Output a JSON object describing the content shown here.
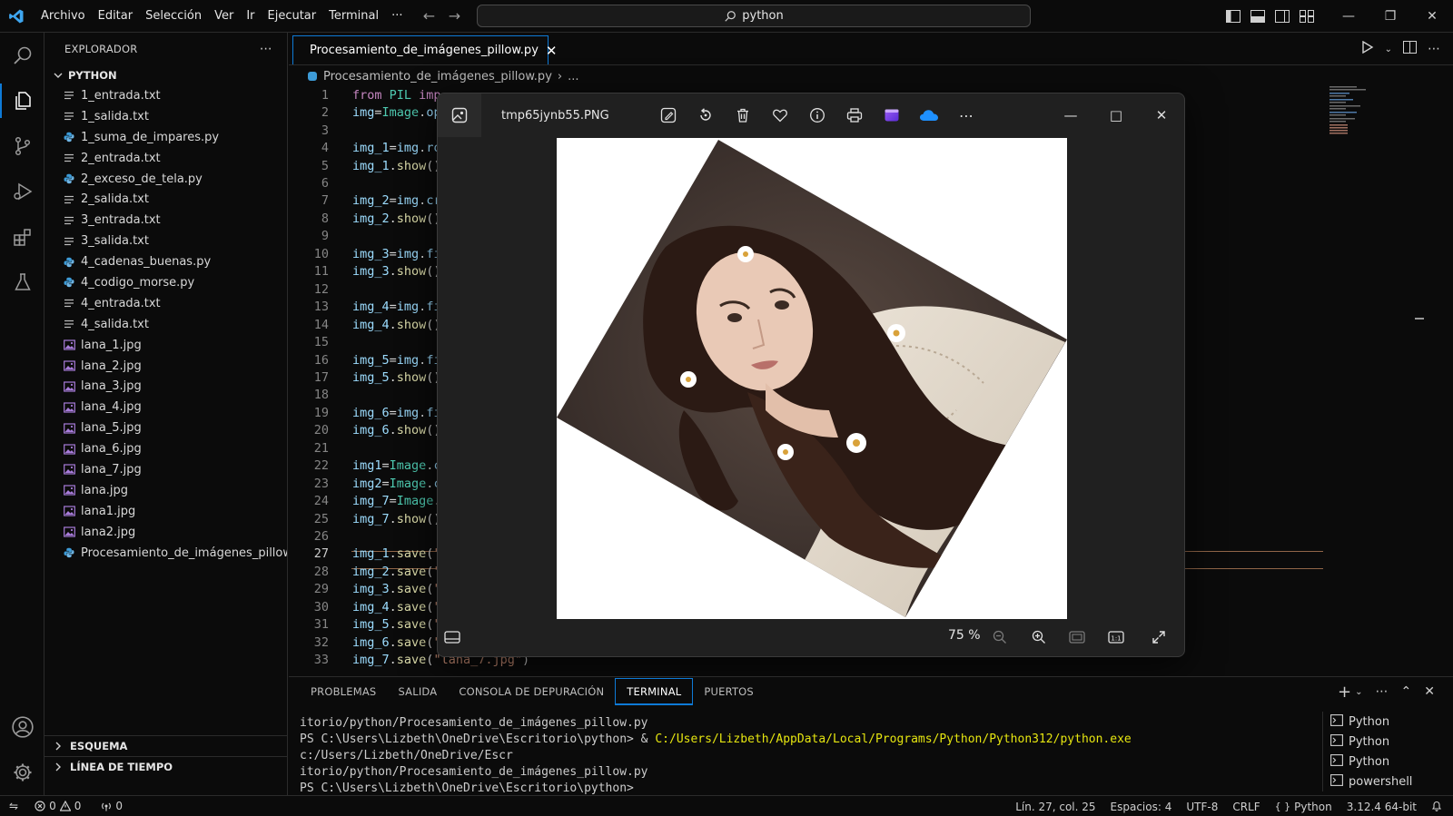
{
  "titlebar": {
    "menu": [
      "Archivo",
      "Editar",
      "Selección",
      "Ver",
      "Ir",
      "Ejecutar",
      "Terminal",
      "···"
    ],
    "search_text": "python"
  },
  "sidebar": {
    "title": "EXPLORADOR",
    "folder": "PYTHON",
    "files": [
      {
        "name": "1_entrada.txt",
        "type": "txt"
      },
      {
        "name": "1_salida.txt",
        "type": "txt"
      },
      {
        "name": "1_suma_de_impares.py",
        "type": "py"
      },
      {
        "name": "2_entrada.txt",
        "type": "txt"
      },
      {
        "name": "2_exceso_de_tela.py",
        "type": "py"
      },
      {
        "name": "2_salida.txt",
        "type": "txt"
      },
      {
        "name": "3_entrada.txt",
        "type": "txt"
      },
      {
        "name": "3_salida.txt",
        "type": "txt"
      },
      {
        "name": "4_cadenas_buenas.py",
        "type": "py"
      },
      {
        "name": "4_codigo_morse.py",
        "type": "py"
      },
      {
        "name": "4_entrada.txt",
        "type": "txt"
      },
      {
        "name": "4_salida.txt",
        "type": "txt"
      },
      {
        "name": "lana_1.jpg",
        "type": "img"
      },
      {
        "name": "lana_2.jpg",
        "type": "img"
      },
      {
        "name": "lana_3.jpg",
        "type": "img"
      },
      {
        "name": "lana_4.jpg",
        "type": "img"
      },
      {
        "name": "lana_5.jpg",
        "type": "img"
      },
      {
        "name": "lana_6.jpg",
        "type": "img"
      },
      {
        "name": "lana_7.jpg",
        "type": "img"
      },
      {
        "name": "lana.jpg",
        "type": "img"
      },
      {
        "name": "lana1.jpg",
        "type": "img"
      },
      {
        "name": "lana2.jpg",
        "type": "img"
      },
      {
        "name": "Procesamiento_de_imágenes_pillow....",
        "type": "py"
      }
    ],
    "outline": "ESQUEMA",
    "timeline": "LÍNEA DE TIEMPO"
  },
  "editor": {
    "tab_label": "Procesamiento_de_imágenes_pillow.py",
    "breadcrumb_file": "Procesamiento_de_imágenes_pillow.py",
    "breadcrumb_more": "...",
    "current_line": 27
  },
  "code_lines": [
    {
      "n": "1",
      "parts": [
        [
          "kw",
          "from "
        ],
        [
          "cls",
          "PIL "
        ],
        [
          "kw",
          "imp"
        ]
      ]
    },
    {
      "n": "2",
      "parts": [
        [
          "var",
          "img"
        ],
        [
          "op",
          "="
        ],
        [
          "cls",
          "Image"
        ],
        [
          "op",
          "."
        ],
        [
          "var",
          "op"
        ]
      ]
    },
    {
      "n": "3",
      "parts": []
    },
    {
      "n": "4",
      "parts": [
        [
          "var",
          "img_1"
        ],
        [
          "op",
          "="
        ],
        [
          "var",
          "img"
        ],
        [
          "op",
          "."
        ],
        [
          "var",
          "ro"
        ]
      ]
    },
    {
      "n": "5",
      "parts": [
        [
          "var",
          "img_1"
        ],
        [
          "op",
          "."
        ],
        [
          "fn",
          "show"
        ],
        [
          "op",
          "()"
        ]
      ]
    },
    {
      "n": "6",
      "parts": []
    },
    {
      "n": "7",
      "parts": [
        [
          "var",
          "img_2"
        ],
        [
          "op",
          "="
        ],
        [
          "var",
          "img"
        ],
        [
          "op",
          "."
        ],
        [
          "var",
          "cr"
        ]
      ]
    },
    {
      "n": "8",
      "parts": [
        [
          "var",
          "img_2"
        ],
        [
          "op",
          "."
        ],
        [
          "fn",
          "show"
        ],
        [
          "op",
          "()"
        ]
      ]
    },
    {
      "n": "9",
      "parts": []
    },
    {
      "n": "10",
      "parts": [
        [
          "var",
          "img_3"
        ],
        [
          "op",
          "="
        ],
        [
          "var",
          "img"
        ],
        [
          "op",
          "."
        ],
        [
          "var",
          "fi"
        ]
      ]
    },
    {
      "n": "11",
      "parts": [
        [
          "var",
          "img_3"
        ],
        [
          "op",
          "."
        ],
        [
          "fn",
          "show"
        ],
        [
          "op",
          "()"
        ]
      ]
    },
    {
      "n": "12",
      "parts": []
    },
    {
      "n": "13",
      "parts": [
        [
          "var",
          "img_4"
        ],
        [
          "op",
          "="
        ],
        [
          "var",
          "img"
        ],
        [
          "op",
          "."
        ],
        [
          "var",
          "fi"
        ]
      ]
    },
    {
      "n": "14",
      "parts": [
        [
          "var",
          "img_4"
        ],
        [
          "op",
          "."
        ],
        [
          "fn",
          "show"
        ],
        [
          "op",
          "()"
        ]
      ]
    },
    {
      "n": "15",
      "parts": []
    },
    {
      "n": "16",
      "parts": [
        [
          "var",
          "img_5"
        ],
        [
          "op",
          "="
        ],
        [
          "var",
          "img"
        ],
        [
          "op",
          "."
        ],
        [
          "var",
          "fi"
        ]
      ]
    },
    {
      "n": "17",
      "parts": [
        [
          "var",
          "img_5"
        ],
        [
          "op",
          "."
        ],
        [
          "fn",
          "show"
        ],
        [
          "op",
          "()"
        ]
      ]
    },
    {
      "n": "18",
      "parts": []
    },
    {
      "n": "19",
      "parts": [
        [
          "var",
          "img_6"
        ],
        [
          "op",
          "="
        ],
        [
          "var",
          "img"
        ],
        [
          "op",
          "."
        ],
        [
          "var",
          "fi"
        ]
      ]
    },
    {
      "n": "20",
      "parts": [
        [
          "var",
          "img_6"
        ],
        [
          "op",
          "."
        ],
        [
          "fn",
          "show"
        ],
        [
          "op",
          "()"
        ]
      ]
    },
    {
      "n": "21",
      "parts": []
    },
    {
      "n": "22",
      "parts": [
        [
          "var",
          "img1"
        ],
        [
          "op",
          "="
        ],
        [
          "cls",
          "Image"
        ],
        [
          "op",
          "."
        ],
        [
          "var",
          "c"
        ]
      ]
    },
    {
      "n": "23",
      "parts": [
        [
          "var",
          "img2"
        ],
        [
          "op",
          "="
        ],
        [
          "cls",
          "Image"
        ],
        [
          "op",
          "."
        ],
        [
          "var",
          "c"
        ]
      ]
    },
    {
      "n": "24",
      "parts": [
        [
          "var",
          "img_7"
        ],
        [
          "op",
          "="
        ],
        [
          "cls",
          "Image"
        ],
        [
          "op",
          "."
        ]
      ]
    },
    {
      "n": "25",
      "parts": [
        [
          "var",
          "img_7"
        ],
        [
          "op",
          "."
        ],
        [
          "fn",
          "show"
        ],
        [
          "op",
          "()"
        ]
      ]
    },
    {
      "n": "26",
      "parts": []
    },
    {
      "n": "27",
      "parts": [
        [
          "var",
          "img_1"
        ],
        [
          "op",
          "."
        ],
        [
          "fn",
          "save"
        ],
        [
          "op",
          "("
        ],
        [
          "str",
          "\""
        ]
      ]
    },
    {
      "n": "28",
      "parts": [
        [
          "var",
          "img_2"
        ],
        [
          "op",
          "."
        ],
        [
          "fn",
          "save"
        ],
        [
          "op",
          "("
        ],
        [
          "str",
          "\""
        ]
      ]
    },
    {
      "n": "29",
      "parts": [
        [
          "var",
          "img_3"
        ],
        [
          "op",
          "."
        ],
        [
          "fn",
          "save"
        ],
        [
          "op",
          "("
        ],
        [
          "str",
          "\""
        ]
      ]
    },
    {
      "n": "30",
      "parts": [
        [
          "var",
          "img_4"
        ],
        [
          "op",
          "."
        ],
        [
          "fn",
          "save"
        ],
        [
          "op",
          "("
        ],
        [
          "str",
          "\""
        ]
      ]
    },
    {
      "n": "31",
      "parts": [
        [
          "var",
          "img_5"
        ],
        [
          "op",
          "."
        ],
        [
          "fn",
          "save"
        ],
        [
          "op",
          "("
        ],
        [
          "str",
          "\""
        ]
      ]
    },
    {
      "n": "32",
      "parts": [
        [
          "var",
          "img_6"
        ],
        [
          "op",
          "."
        ],
        [
          "fn",
          "save"
        ],
        [
          "op",
          "("
        ],
        [
          "str",
          "\""
        ]
      ]
    },
    {
      "n": "33",
      "parts": [
        [
          "var",
          "img_7"
        ],
        [
          "op",
          "."
        ],
        [
          "fn",
          "save"
        ],
        [
          "op",
          "("
        ],
        [
          "str",
          "\"lana_7.jpg\""
        ],
        [
          "op",
          ")"
        ]
      ]
    }
  ],
  "viewer": {
    "filename": "tmp65jynb55.PNG",
    "zoom": "75 %"
  },
  "panel": {
    "tabs": [
      "PROBLEMAS",
      "SALIDA",
      "CONSOLA DE DEPURACIÓN",
      "TERMINAL",
      "PUERTOS"
    ],
    "active_tab": "TERMINAL",
    "terminal_lines": [
      [
        [
          "plain",
          "itorio/python/Procesamiento_de_imágenes_pillow.py"
        ]
      ],
      [
        [
          "plain",
          "PS C:\\Users\\Lizbeth\\OneDrive\\Escritorio\\python> & "
        ],
        [
          "yel",
          "C:/Users/Lizbeth/AppData/Local/Programs/Python/Python312/python.exe"
        ],
        [
          "plain",
          " c:/Users/Lizbeth/OneDrive/Escr"
        ]
      ],
      [
        [
          "plain",
          "itorio/python/Procesamiento_de_imágenes_pillow.py"
        ]
      ],
      [
        [
          "plain",
          "PS C:\\Users\\Lizbeth\\OneDrive\\Escritorio\\python>"
        ]
      ]
    ],
    "terminals": [
      "Python",
      "Python",
      "Python",
      "powershell"
    ]
  },
  "statusbar": {
    "errors": "0",
    "warnings": "0",
    "ports": "0",
    "position": "Lín. 27, col. 25",
    "spaces": "Espacios: 4",
    "encoding": "UTF-8",
    "eol": "CRLF",
    "language": "Python",
    "interpreter": "3.12.4 64-bit"
  },
  "colors": {
    "accent": "#0e7ad6",
    "keyword": "#c586c0",
    "class": "#4ec9b0",
    "function": "#dcdcaa",
    "string": "#ce9178",
    "variable": "#9cdcfe"
  }
}
